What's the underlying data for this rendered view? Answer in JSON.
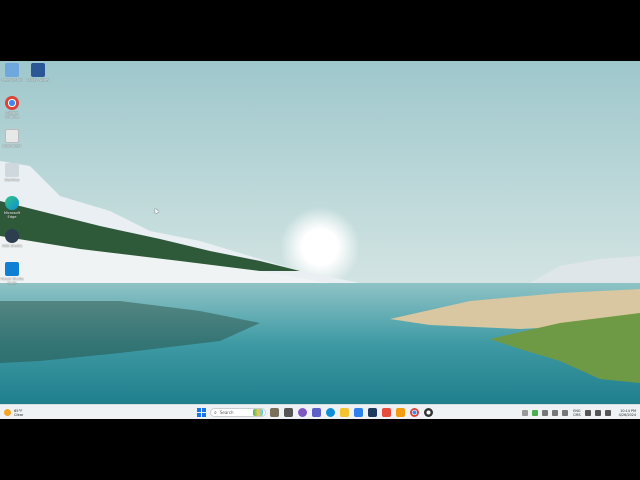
{
  "desktop": {
    "icons": [
      {
        "label": "Recycle Bin",
        "icon": "recycle-bin-icon",
        "color": "#6fa8dc"
      },
      {
        "label": "Sticky Notes",
        "icon": "app-shortcut-icon",
        "color": "#2b5797"
      },
      {
        "label": "Google Chrome",
        "icon": "chrome-icon",
        "color": "#db4437"
      },
      {
        "label": "Document",
        "icon": "document-icon",
        "color": "#e8e8e8"
      },
      {
        "label": "Desktop",
        "icon": "image-file-icon",
        "color": "#cfd8dc"
      },
      {
        "label": "Microsoft Edge",
        "icon": "edge-icon",
        "color": "#0c8fd6"
      },
      {
        "label": "OBS Studio",
        "icon": "obs-icon",
        "color": "#2c3e50"
      },
      {
        "label": "Visual Studio Code",
        "icon": "vscode-icon",
        "color": "#0e7fd3"
      }
    ]
  },
  "taskbar": {
    "weather": {
      "temp": "65°F",
      "condition": "Clear"
    },
    "search_placeholder": "Search",
    "pinned": [
      {
        "name": "file-explorer-taskbar-icon",
        "color": "#7b6f5b"
      },
      {
        "name": "widgets-taskbar-icon",
        "color": "#555555"
      },
      {
        "name": "copilot-taskbar-icon",
        "color": "#7e57c2"
      },
      {
        "name": "teams-taskbar-icon",
        "color": "#5b5fc7"
      },
      {
        "name": "edge-taskbar-icon",
        "color": "#0c8fd6"
      },
      {
        "name": "folder-taskbar-icon",
        "color": "#f4c430"
      },
      {
        "name": "store-taskbar-icon",
        "color": "#2f80ed"
      },
      {
        "name": "terminal-taskbar-icon",
        "color": "#1e3a5f"
      },
      {
        "name": "ludo-taskbar-icon",
        "color": "#e74c3c"
      },
      {
        "name": "sticky-taskbar-icon",
        "color": "#f39c12"
      },
      {
        "name": "chrome-taskbar-icon",
        "color": "#db4437"
      },
      {
        "name": "obs-taskbar-icon",
        "color": "#333333"
      }
    ],
    "tray": {
      "lang_top": "ENG",
      "lang_bottom": "CMS",
      "time": "10:14 PM",
      "date": "4/26/2024"
    }
  }
}
